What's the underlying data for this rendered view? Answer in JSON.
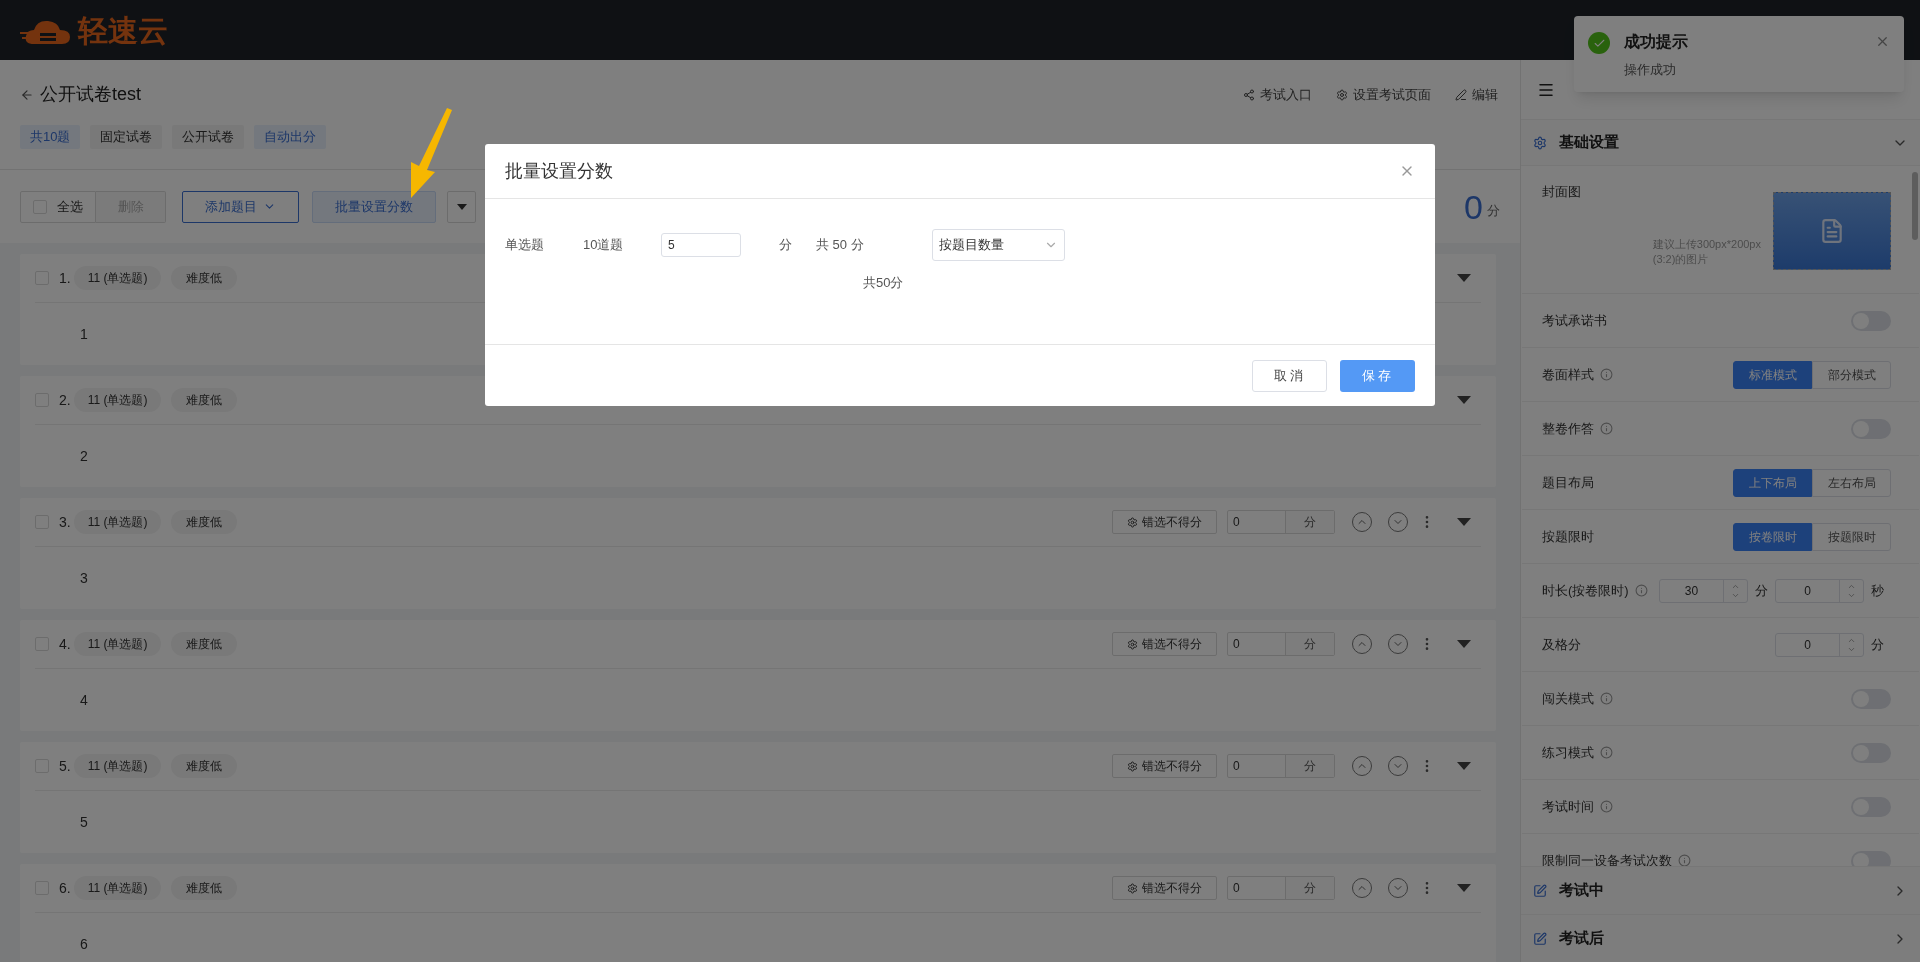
{
  "header": {
    "logo_text": "轻速云"
  },
  "toast": {
    "title": "成功提示",
    "message": "操作成功"
  },
  "paper": {
    "title": "公开试卷test",
    "actions": [
      {
        "kind": "share",
        "label": "考试入口"
      },
      {
        "kind": "settings",
        "label": "设置考试页面"
      },
      {
        "kind": "edit",
        "label": "编辑"
      }
    ],
    "tags": [
      {
        "label": "共10题",
        "kind": "primary"
      },
      {
        "label": "固定试卷",
        "kind": "plain"
      },
      {
        "label": "公开试卷",
        "kind": "plain"
      },
      {
        "label": "自动出分",
        "kind": "primary"
      }
    ]
  },
  "toolbar": {
    "select_all": {
      "label": "全选",
      "checked": false
    },
    "delete": {
      "label": "删除",
      "disabled": true
    },
    "add": "添加题目",
    "batch": "批量设置分数",
    "total": {
      "value": "0",
      "unit": "分"
    }
  },
  "questions": [
    {
      "number": "1.",
      "type": "11 (单选题)",
      "difficulty": "难度低",
      "content": "1",
      "checked": false
    },
    {
      "number": "2.",
      "type": "11 (单选题)",
      "difficulty": "难度低",
      "content": "2",
      "checked": false
    },
    {
      "number": "3.",
      "type": "11 (单选题)",
      "difficulty": "难度低",
      "content": "3",
      "checked": false,
      "wrong_choice": "错选不得分",
      "score": "0",
      "unit": "分"
    },
    {
      "number": "4.",
      "type": "11 (单选题)",
      "difficulty": "难度低",
      "content": "4",
      "checked": false,
      "wrong_choice": "错选不得分",
      "score": "0",
      "unit": "分"
    },
    {
      "number": "5.",
      "type": "11 (单选题)",
      "difficulty": "难度低",
      "content": "5",
      "checked": false,
      "wrong_choice": "错选不得分",
      "score": "0",
      "unit": "分"
    },
    {
      "number": "6.",
      "type": "11 (单选题)",
      "difficulty": "难度低",
      "content": "6",
      "checked": false,
      "wrong_choice": "错选不得分",
      "score": "0",
      "unit": "分"
    }
  ],
  "settings": {
    "section": {
      "title": "基础设置",
      "expanded": true
    },
    "rows": [
      {
        "kind": "cover",
        "label": "封面图",
        "info": false,
        "hint_lines": [
          "建议上传300px*200px",
          "(3:2)的图片"
        ]
      },
      {
        "kind": "toggle",
        "label": "考试承诺书",
        "info": false,
        "on": false
      },
      {
        "kind": "segmented",
        "label": "卷面样式",
        "info": true,
        "options": [
          {
            "label": "标准模式",
            "selected": true
          },
          {
            "label": "部分模式",
            "selected": false
          }
        ]
      },
      {
        "kind": "toggle",
        "label": "整卷作答",
        "info": true,
        "on": false
      },
      {
        "kind": "segmented",
        "label": "题目布局",
        "info": false,
        "options": [
          {
            "label": "上下布局",
            "selected": true
          },
          {
            "label": "左右布局",
            "selected": false
          }
        ]
      },
      {
        "kind": "segmented",
        "label": "按题限时",
        "info": false,
        "options": [
          {
            "label": "按卷限时",
            "selected": true
          },
          {
            "label": "按题限时",
            "selected": false
          }
        ]
      },
      {
        "kind": "number",
        "label": "时长(按卷限时)",
        "info": true,
        "fields": [
          {
            "value": "30",
            "unit": "分"
          },
          {
            "value": "0",
            "unit": "秒"
          }
        ]
      },
      {
        "kind": "number",
        "label": "及格分",
        "info": false,
        "fields": [
          {
            "value": "0",
            "unit": "分"
          }
        ]
      },
      {
        "kind": "toggle",
        "label": "闯关模式",
        "info": true,
        "on": false
      },
      {
        "kind": "toggle",
        "label": "练习模式",
        "info": true,
        "on": false
      },
      {
        "kind": "toggle",
        "label": "考试时间",
        "info": true,
        "on": false
      },
      {
        "kind": "toggle",
        "label": "限制同一设备考试次数",
        "info": true,
        "on": false
      }
    ],
    "collapsed_sections": [
      {
        "title": "考试中"
      },
      {
        "title": "考试后"
      }
    ]
  },
  "dialog": {
    "title": "批量设置分数",
    "rows": [
      {
        "type": "单选题",
        "count": "10道题",
        "score": "5",
        "unit": "分",
        "subtotal": "共 50 分",
        "mode": "按题目数量"
      }
    ],
    "total": "共50分",
    "buttons": [
      {
        "label": "取消",
        "kind": "default"
      },
      {
        "label": "保存",
        "kind": "primary"
      }
    ]
  }
}
